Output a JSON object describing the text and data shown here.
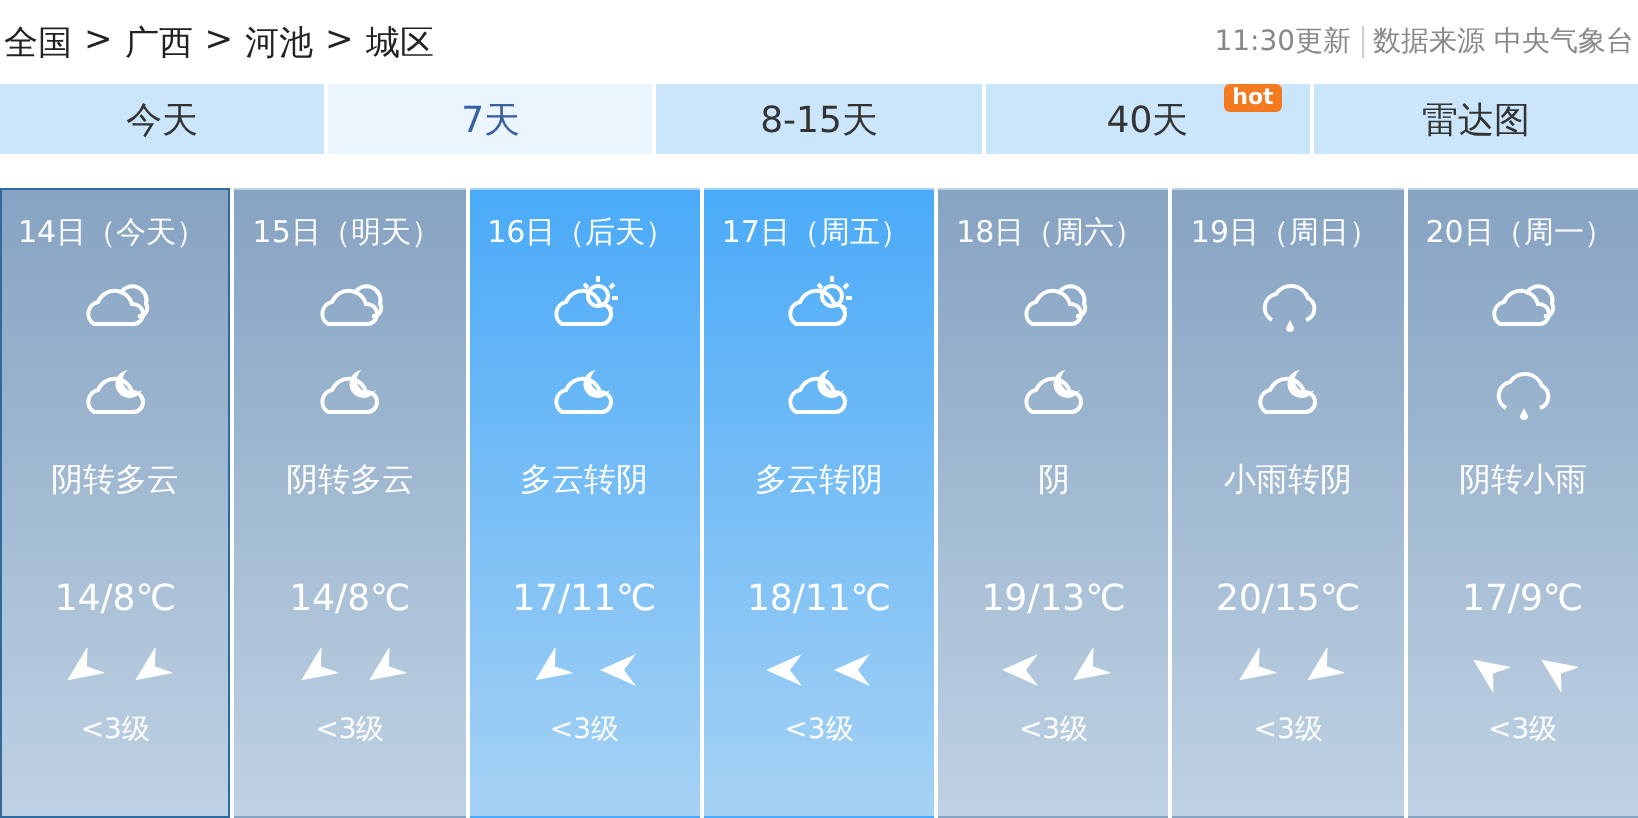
{
  "breadcrumb": [
    "全国",
    "广西",
    "河池",
    "城区"
  ],
  "breadcrumb_separator": ">",
  "update": {
    "time": "11:30更新",
    "source": "数据来源 中央气象台"
  },
  "tabs": [
    {
      "label": "今天",
      "selected": false
    },
    {
      "label": "7天",
      "selected": true
    },
    {
      "label": "8-15天",
      "selected": false
    },
    {
      "label": "40天",
      "selected": false,
      "badge": "hot"
    },
    {
      "label": "雷达图",
      "selected": false
    }
  ],
  "days": [
    {
      "date": "14日（今天）",
      "kind": "overcast",
      "selected": true,
      "icons": [
        {
          "kind": "cloudy"
        },
        {
          "kind": "moon-cloud"
        }
      ],
      "weather": "阴转多云",
      "temp": "14/8℃",
      "wind": [
        {
          "kind": "southwest"
        },
        {
          "kind": "southwest"
        }
      ],
      "wind_level": "<3级"
    },
    {
      "date": "15日（明天）",
      "kind": "overcast",
      "selected": false,
      "icons": [
        {
          "kind": "cloudy"
        },
        {
          "kind": "moon-cloud"
        }
      ],
      "weather": "阴转多云",
      "temp": "14/8℃",
      "wind": [
        {
          "kind": "southwest"
        },
        {
          "kind": "southwest"
        }
      ],
      "wind_level": "<3级"
    },
    {
      "date": "16日（后天）",
      "kind": "clear",
      "selected": false,
      "icons": [
        {
          "kind": "sun-cloud"
        },
        {
          "kind": "moon-cloud"
        }
      ],
      "weather": "多云转阴",
      "temp": "17/11℃",
      "wind": [
        {
          "kind": "southwest"
        },
        {
          "kind": "west"
        }
      ],
      "wind_level": "<3级"
    },
    {
      "date": "17日（周五）",
      "kind": "clear",
      "selected": false,
      "icons": [
        {
          "kind": "sun-cloud"
        },
        {
          "kind": "moon-cloud"
        }
      ],
      "weather": "多云转阴",
      "temp": "18/11℃",
      "wind": [
        {
          "kind": "west"
        },
        {
          "kind": "west"
        }
      ],
      "wind_level": "<3级"
    },
    {
      "date": "18日（周六）",
      "kind": "overcast",
      "selected": false,
      "icons": [
        {
          "kind": "cloudy"
        },
        {
          "kind": "moon-cloud"
        }
      ],
      "weather": "阴",
      "temp": "19/13℃",
      "wind": [
        {
          "kind": "west"
        },
        {
          "kind": "southwest"
        }
      ],
      "wind_level": "<3级"
    },
    {
      "date": "19日（周日）",
      "kind": "overcast",
      "selected": false,
      "icons": [
        {
          "kind": "rain"
        },
        {
          "kind": "moon-cloud"
        }
      ],
      "weather": "小雨转阴",
      "temp": "20/15℃",
      "wind": [
        {
          "kind": "southwest"
        },
        {
          "kind": "southwest"
        }
      ],
      "wind_level": "<3级"
    },
    {
      "date": "20日（周一）",
      "kind": "overcast",
      "selected": false,
      "icons": [
        {
          "kind": "cloudy"
        },
        {
          "kind": "rain"
        }
      ],
      "weather": "阴转小雨",
      "temp": "17/9℃",
      "wind": [
        {
          "kind": "northwest"
        },
        {
          "kind": "northwest"
        }
      ],
      "wind_level": "<3级"
    }
  ]
}
